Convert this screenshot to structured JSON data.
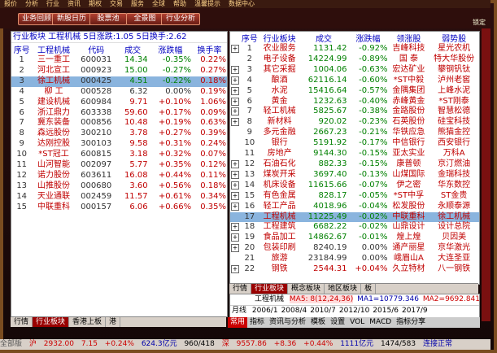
{
  "topbar": [
    "报价",
    "分析",
    "行业",
    "资讯",
    "期权",
    "交易",
    "服务",
    "全球",
    "帮助",
    "温馨提示",
    "数据中心"
  ],
  "toolbar": {
    "buttons": [
      "业务回顾",
      "新股日历",
      "股票池",
      "全景图",
      "行业分析"
    ],
    "right_label": "锁定"
  },
  "left": {
    "header": "行业板块  工程机械 5日涨跌:1.05 5日换手:2.62",
    "change_label": "5日换手",
    "columns": [
      "序号",
      "工程机械",
      "代码",
      "成交",
      "涨跌幅",
      "换手率"
    ],
    "rows": [
      {
        "no": "1",
        "name": "三一重工",
        "code": "600031",
        "price": "14.34",
        "pct": "-0.35%",
        "turn": "0.22%",
        "dir": "dn"
      },
      {
        "no": "2",
        "name": "河北宣工",
        "code": "000923",
        "price": "15.00",
        "pct": "-0.27%",
        "turn": "0.27%",
        "dir": "dn"
      },
      {
        "no": "3",
        "name": "徐工机械",
        "code": "000425",
        "price": "4.51",
        "pct": "-0.22%",
        "turn": "0.18%",
        "dir": "dn"
      },
      {
        "no": "4",
        "name": "柳  工",
        "code": "000528",
        "price": "6.32",
        "pct": "0.00%",
        "turn": "0.19%",
        "dir": "flat"
      },
      {
        "no": "5",
        "name": "建设机械",
        "code": "600984",
        "price": "9.71",
        "pct": "+0.10%",
        "turn": "1.06%",
        "dir": "up"
      },
      {
        "no": "6",
        "name": "浙江鼎力",
        "code": "603338",
        "price": "59.60",
        "pct": "+0.17%",
        "turn": "0.09%",
        "dir": "up"
      },
      {
        "no": "7",
        "name": "冀东装备",
        "code": "000856",
        "price": "10.48",
        "pct": "+0.19%",
        "turn": "0.63%",
        "dir": "up"
      },
      {
        "no": "8",
        "name": "森远股份",
        "code": "300210",
        "price": "3.78",
        "pct": "+0.27%",
        "turn": "0.39%",
        "dir": "up"
      },
      {
        "no": "9",
        "name": "达刚控股",
        "code": "300103",
        "price": "9.58",
        "pct": "+0.31%",
        "turn": "0.24%",
        "dir": "up"
      },
      {
        "no": "10",
        "name": "*ST冠工",
        "code": "600815",
        "price": "3.18",
        "pct": "+0.32%",
        "turn": "0.07%",
        "dir": "up"
      },
      {
        "no": "11",
        "name": "山河智能",
        "code": "002097",
        "price": "5.77",
        "pct": "+0.35%",
        "turn": "0.12%",
        "dir": "up"
      },
      {
        "no": "12",
        "name": "诺力股份",
        "code": "603611",
        "price": "16.08",
        "pct": "+0.44%",
        "turn": "0.11%",
        "dir": "up"
      },
      {
        "no": "13",
        "name": "山推股份",
        "code": "000680",
        "price": "3.60",
        "pct": "+0.56%",
        "turn": "0.18%",
        "dir": "up"
      },
      {
        "no": "14",
        "name": "天业通联",
        "code": "002459",
        "price": "11.57",
        "pct": "+0.61%",
        "turn": "0.34%",
        "dir": "up"
      },
      {
        "no": "15",
        "name": "中联重科",
        "code": "000157",
        "price": "6.06",
        "pct": "+0.66%",
        "turn": "0.35%",
        "dir": "up"
      }
    ],
    "tabs": [
      "行情",
      "行业板块",
      "香港上板",
      "港"
    ]
  },
  "right": {
    "columns": [
      "序号",
      "行业板块",
      "成交",
      "涨跌幅",
      "领涨股",
      "弱势股"
    ],
    "rows": [
      {
        "plus": "+",
        "no": "1",
        "name": "农业服务",
        "price": "1131.42",
        "pct": "-0.92%",
        "lead": "吉峰科技",
        "weak": "星光农机",
        "dir": "dn"
      },
      {
        "plus": "",
        "no": "2",
        "name": "电子设备",
        "price": "14224.99",
        "pct": "-0.89%",
        "lead": "国  泰",
        "weak": "特大华股份",
        "dir": "dn"
      },
      {
        "plus": "+",
        "no": "3",
        "name": "其它采掘",
        "price": "1004.06",
        "pct": "-0.63%",
        "lead": "宏达矿业",
        "weak": "攀钢钒钛",
        "dir": "dn"
      },
      {
        "plus": "+",
        "no": "4",
        "name": "酿酒",
        "price": "62116.14",
        "pct": "-0.60%",
        "lead": "*ST中毅",
        "weak": "泸州老窖",
        "dir": "dn"
      },
      {
        "plus": "+",
        "no": "5",
        "name": "水泥",
        "price": "15416.64",
        "pct": "-0.57%",
        "lead": "金隅集团",
        "weak": "上峰水泥",
        "dir": "dn"
      },
      {
        "plus": "+",
        "no": "6",
        "name": "黄金",
        "price": "1232.63",
        "pct": "-0.40%",
        "lead": "赤峰黄金",
        "weak": "*ST刚泰",
        "dir": "dn"
      },
      {
        "plus": "+",
        "no": "7",
        "name": "轻工机械",
        "price": "5825.67",
        "pct": "-0.38%",
        "lead": "金路股份",
        "weak": "智慧松德",
        "dir": "dn"
      },
      {
        "plus": "+",
        "no": "8",
        "name": "新材料",
        "price": "920.02",
        "pct": "-0.23%",
        "lead": "石英股份",
        "weak": "硅宝科技",
        "dir": "dn"
      },
      {
        "plus": "",
        "no": "9",
        "name": "多元金融",
        "price": "2667.23",
        "pct": "-0.21%",
        "lead": "华铁应急",
        "weak": "熊猫金控",
        "dir": "dn"
      },
      {
        "plus": "",
        "no": "10",
        "name": "银行",
        "price": "5191.92",
        "pct": "-0.17%",
        "lead": "中信银行",
        "weak": "西安银行",
        "dir": "dn"
      },
      {
        "plus": "",
        "no": "11",
        "name": "房地产",
        "price": "9144.30",
        "pct": "-0.15%",
        "lead": "亚太实业",
        "weak": "万科A",
        "dir": "dn"
      },
      {
        "plus": "+",
        "no": "12",
        "name": "石油石化",
        "price": "882.33",
        "pct": "-0.15%",
        "lead": "康普顿",
        "weak": "京汀燃油",
        "dir": "dn"
      },
      {
        "plus": "+",
        "no": "13",
        "name": "煤炭开采",
        "price": "3697.40",
        "pct": "-0.13%",
        "lead": "山煤国际",
        "weak": "金瑞科技",
        "dir": "dn"
      },
      {
        "plus": "+",
        "no": "14",
        "name": "机床设备",
        "price": "11615.66",
        "pct": "-0.07%",
        "lead": "伊之密",
        "weak": "华东数控",
        "dir": "dn"
      },
      {
        "plus": "+",
        "no": "15",
        "name": "有色金属",
        "price": "828.17",
        "pct": "-0.05%",
        "lead": "*ST中孚",
        "weak": "ST金贵",
        "dir": "dn"
      },
      {
        "plus": "+",
        "no": "16",
        "name": "轻工产品",
        "price": "4018.96",
        "pct": "-0.04%",
        "lead": "松发股份",
        "weak": "永顺泰源",
        "dir": "dn"
      },
      {
        "plus": "",
        "no": "17",
        "name": "工程机械",
        "price": "11225.49",
        "pct": "-0.02%",
        "lead": "中联重科",
        "weak": "徐工机械",
        "dir": "dn"
      },
      {
        "plus": "+",
        "no": "18",
        "name": "工程建筑",
        "price": "6682.22",
        "pct": "-0.02%",
        "lead": "山鼎设计",
        "weak": "设计总院",
        "dir": "dn"
      },
      {
        "plus": "+",
        "no": "19",
        "name": "食品加工",
        "price": "14862.67",
        "pct": "-0.01%",
        "lead": "煌上煌",
        "weak": "贝因美",
        "dir": "dn"
      },
      {
        "plus": "+",
        "no": "20",
        "name": "包装印刷",
        "price": "8240.19",
        "pct": "0.00%",
        "lead": "通产丽星",
        "weak": "京华激光",
        "dir": "flat"
      },
      {
        "plus": "",
        "no": "21",
        "name": "旅游",
        "price": "23184.99",
        "pct": "0.00%",
        "lead": "峨眉山A",
        "weak": "大连圣亚",
        "dir": "flat"
      },
      {
        "plus": "+",
        "no": "22",
        "name": "钢铁",
        "price": "2544.31",
        "pct": "+0.04%",
        "lead": "久立特材",
        "weak": "八一钢铁",
        "dir": "up"
      }
    ],
    "tabs": [
      "行情",
      "行业板块",
      "概念板块",
      "地区板块",
      "板"
    ]
  },
  "kline": {
    "title": "工程机械",
    "ma_labels": [
      "MA5: 8(12,24,36)",
      "MA1=10779.346",
      "MA2=9692.841"
    ],
    "period_label": "月线",
    "years": [
      "2006/1",
      "2008/4",
      "2010/7",
      "2012/10",
      "2015/6",
      "2017/9"
    ]
  },
  "mid_tabs": [
    "常用",
    "指标",
    "资讯与分析",
    "模板",
    "设置",
    "VOL",
    "MACD",
    "指标分享"
  ],
  "bottom": {
    "sh_label": "沪",
    "sh_index": "2932.00",
    "sh_change": "7.15",
    "sh_pct": "+0.24%",
    "sh_amount": "624.3亿元",
    "sh_count": "960/418",
    "sz_label": "深",
    "sz_index": "9557.86",
    "sz_change": "+8.36",
    "sz_pct": "+0.44%",
    "sz_amount": "1111亿元",
    "sz_count": "1474/583",
    "conn": "连接正常",
    "app_label": "全部版"
  },
  "colors": {
    "up": "#c00000",
    "down": "#008000",
    "frame": "#7a4c20"
  }
}
